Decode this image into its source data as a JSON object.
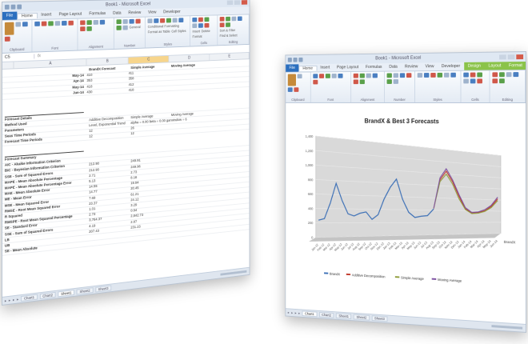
{
  "left_window": {
    "title": "Book1 - Microsoft Excel",
    "tabs": [
      "File",
      "Home",
      "Insert",
      "Page Layout",
      "Formulas",
      "Data",
      "Review",
      "View",
      "Developer"
    ],
    "ribbon_groups": [
      "Clipboard",
      "Font",
      "Alignment",
      "Number",
      "Styles",
      "Cells",
      "Editing"
    ],
    "ribbon_items": [
      "General",
      "Conditional Formatting",
      "Format as Table",
      "Cell Styles",
      "Insert",
      "Delete",
      "Format",
      "Sort & Filter",
      "Find & Select"
    ],
    "name_box": "C5",
    "fx": "fx",
    "columns": [
      "A",
      "B",
      "C",
      "D",
      "E"
    ],
    "header_row": [
      "BrandX Forecast",
      "Simple Average",
      "Moving Average"
    ],
    "date_rows": [
      {
        "label": "May-14",
        "b": "410",
        "c": "411"
      },
      {
        "label": "Apr-14",
        "b": "353",
        "c": "358"
      },
      {
        "label": "May-14",
        "b": "418",
        "c": "412"
      },
      {
        "label": "Jun-14",
        "b": "430",
        "c": "418"
      }
    ],
    "details_title": "Forecast Details",
    "details_rows": [
      {
        "label": "Method Used",
        "b": "Additive Decomposition",
        "c": "Simple Average",
        "d": "Moving Average"
      },
      {
        "label": "Parameters",
        "b": "Level, Exponential Trend",
        "c": "alpha = 0.00 beta = 0.00 gamma = 0.00",
        "d": "window = 6"
      },
      {
        "label": "Seas Time Periods",
        "b": "12",
        "c": "26",
        "d": ""
      },
      {
        "label": "Forecast Time Periods",
        "b": "12",
        "c": "12",
        "d": ""
      }
    ],
    "summary_title": "Forecast Summary",
    "summary_rows": [
      {
        "label": "AIC - Akaike Information Criterion",
        "b": "",
        "c": ""
      },
      {
        "label": "BIC - Bayesian Information Criterion",
        "b": "212.90",
        "c": "249.91"
      },
      {
        "label": "SSE - Sum of Squared Errors",
        "b": "212.90",
        "c": "249.96"
      },
      {
        "label": "MAPE - Mean Absolute Percentage",
        "b": "2.71",
        "c": "2.73"
      },
      {
        "label": "MAPE - Mean Absolute Percentage Error",
        "b": "5.13",
        "c": "8.18"
      },
      {
        "label": "MAE - Mean Absolute Error",
        "b": "14.55",
        "c": "19.94"
      },
      {
        "label": "ME - Mean Error",
        "b": "14.77",
        "c": "20.45"
      },
      {
        "label": "MSE - Mean Squared Error",
        "b": "7.69",
        "c": "61.21"
      },
      {
        "label": "RMSE - Root Mean Squared Error",
        "b": "23.37",
        "c": "24.12"
      },
      {
        "label": "R Squared",
        "b": "1.01",
        "c": "3.29"
      },
      {
        "label": "RMSPE - Root Mean Squared Percentage",
        "b": "2.73",
        "c": "0.94"
      },
      {
        "label": "SE - Standard Error",
        "b": "3,764.37",
        "c": "2,842.73"
      },
      {
        "label": "SSE - Sum of Squared Errors",
        "b": "4.19",
        "c": "2.87"
      },
      {
        "label": "LB",
        "b": "207.43",
        "c": "231.23"
      },
      {
        "label": "UB",
        "b": "",
        "c": ""
      },
      {
        "label": "SE - Mean Absolute",
        "b": "",
        "c": ""
      }
    ],
    "sheet_tabs": [
      "Chart1",
      "Chart2",
      "Sheet1",
      "Sheet2",
      "Sheet3"
    ],
    "active_sheet": "Sheet1"
  },
  "right_window": {
    "title": "Book1 - Microsoft Excel",
    "context_tab": "Chart Tools",
    "tabs": [
      "File",
      "Home",
      "Insert",
      "Page Layout",
      "Formulas",
      "Data",
      "Review",
      "View",
      "Developer",
      "Design",
      "Layout",
      "Format"
    ],
    "ribbon_groups": [
      "Clipboard",
      "Font",
      "Alignment",
      "Number",
      "Styles",
      "Cells",
      "Editing"
    ],
    "sheet_tabs": [
      "Chart1",
      "Chart2",
      "Sheet1",
      "Sheet2",
      "Sheet3"
    ],
    "active_sheet": "Chart1"
  },
  "chart_data": {
    "type": "line",
    "title": "BrandX & Best 3 Forecasts",
    "ylim": [
      0,
      1400
    ],
    "y_ticks": [
      "0",
      "200",
      "400",
      "600",
      "800",
      "1,000",
      "1,200",
      "1,400"
    ],
    "x": [
      "Jan-12",
      "Feb-12",
      "Mar-12",
      "Apr-12",
      "May-12",
      "Jun-12",
      "Jul-12",
      "Aug-12",
      "Sep-12",
      "Oct-12",
      "Nov-12",
      "Dec-12",
      "Jan-13",
      "Feb-13",
      "Mar-13",
      "Apr-13",
      "May-13",
      "Jun-13",
      "Jul-13",
      "Aug-13",
      "Sep-13",
      "Oct-13",
      "Nov-13",
      "Dec-13",
      "Jan-14",
      "Feb-14",
      "Mar-14",
      "Apr-14",
      "May-14",
      "Jun-14"
    ],
    "series": [
      {
        "name": "BrandX",
        "color": "#3b6fb6",
        "values": [
          240,
          260,
          480,
          760,
          520,
          330,
          300,
          340,
          360,
          250,
          320,
          560,
          740,
          870,
          560,
          360,
          280,
          300,
          310,
          420,
          null,
          null,
          null,
          null,
          null,
          null,
          null,
          null,
          null,
          null
        ]
      },
      {
        "name": "Additive Decomposition",
        "color": "#c0392b",
        "values": [
          null,
          null,
          null,
          null,
          null,
          null,
          null,
          null,
          null,
          null,
          null,
          null,
          null,
          null,
          null,
          null,
          null,
          null,
          null,
          430,
          900,
          1050,
          880,
          640,
          430,
          360,
          370,
          400,
          480,
          620
        ]
      },
      {
        "name": "Simple Average",
        "color": "#8e9c3a",
        "values": [
          null,
          null,
          null,
          null,
          null,
          null,
          null,
          null,
          null,
          null,
          null,
          null,
          null,
          null,
          null,
          null,
          null,
          null,
          null,
          430,
          870,
          1000,
          840,
          600,
          420,
          350,
          360,
          390,
          460,
          590
        ]
      },
      {
        "name": "Moving Average",
        "color": "#7b4fa0",
        "values": [
          null,
          null,
          null,
          null,
          null,
          null,
          null,
          null,
          null,
          null,
          null,
          null,
          null,
          null,
          null,
          null,
          null,
          null,
          null,
          430,
          930,
          1090,
          910,
          670,
          450,
          370,
          380,
          420,
          500,
          650
        ]
      }
    ],
    "legend": [
      "BrandX",
      "Additive Decomposition",
      "Simple Average",
      "Moving Average"
    ],
    "legend_position": "bottom",
    "series_axis_label": "BrandX",
    "grid": true
  }
}
